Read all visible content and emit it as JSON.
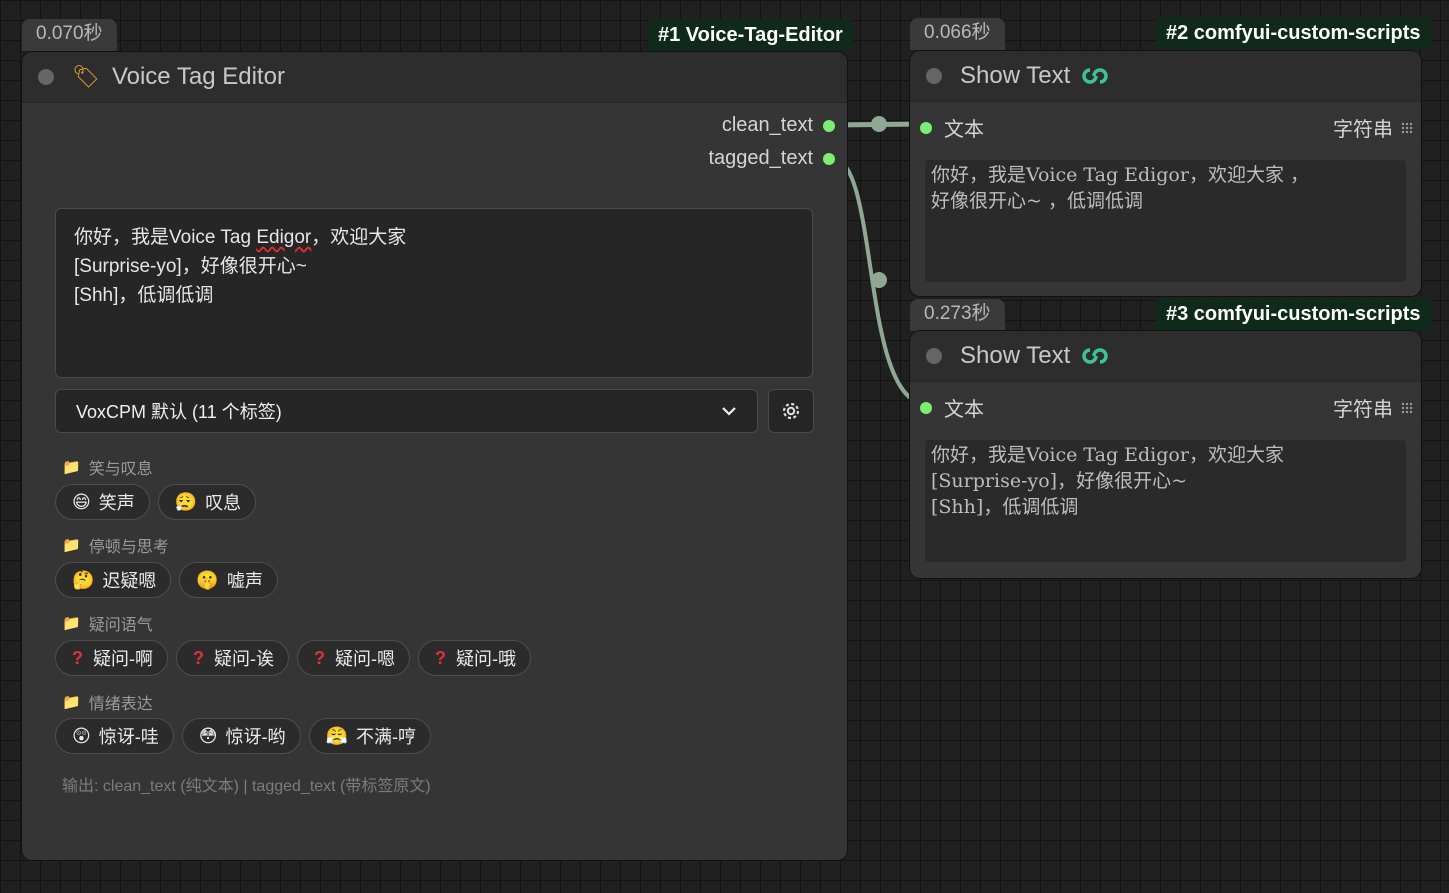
{
  "nodes": {
    "voice_tag_editor": {
      "time": "0.070秒",
      "badge": "#1 Voice-Tag-Editor",
      "title": "Voice Tag Editor",
      "outputs": [
        "clean_text",
        "tagged_text"
      ],
      "text_lines": [
        "你好，我是Voice Tag ",
        "Edigor",
        "，欢迎大家",
        "[Surprise-yo]，好像很开心~",
        "[Shh]，低调低调"
      ],
      "preset_select": "VoxCPM 默认 (11 个标签)",
      "categories": [
        {
          "name": "笑与叹息",
          "tags": [
            {
              "emoji": "😄",
              "label": "笑声"
            },
            {
              "emoji": "😮‍💨",
              "label": "叹息"
            }
          ]
        },
        {
          "name": "停顿与思考",
          "tags": [
            {
              "emoji": "🤔",
              "label": "迟疑嗯"
            },
            {
              "emoji": "🤫",
              "label": "嘘声"
            }
          ]
        },
        {
          "name": "疑问语气",
          "tags": [
            {
              "emoji": "?",
              "label": "疑问-啊"
            },
            {
              "emoji": "?",
              "label": "疑问-诶"
            },
            {
              "emoji": "?",
              "label": "疑问-嗯"
            },
            {
              "emoji": "?",
              "label": "疑问-哦"
            }
          ]
        },
        {
          "name": "情绪表达",
          "tags": [
            {
              "emoji": "😲",
              "label": "惊讶-哇"
            },
            {
              "emoji": "😳",
              "label": "惊讶-哟"
            },
            {
              "emoji": "😤",
              "label": "不满-哼"
            }
          ]
        }
      ],
      "footer": "输出: clean_text (纯文本) | tagged_text (带标签原文)"
    },
    "show_text_2": {
      "time": "0.066秒",
      "badge": "#2 comfyui-custom-scripts",
      "title": "Show Text",
      "input_label": "文本",
      "input_type": "字符串",
      "lines": [
        "你好，我是Voice Tag Edigor，欢迎大家 ，",
        "好像很开心~ ，低调低调"
      ]
    },
    "show_text_3": {
      "time": "0.273秒",
      "badge": "#3 comfyui-custom-scripts",
      "title": "Show Text",
      "input_label": "文本",
      "input_type": "字符串",
      "lines": [
        "你好，我是Voice Tag Edigor，欢迎大家",
        "[Surprise-yo]，好像很开心~",
        "[Shh]，低调低调"
      ]
    }
  },
  "colors": {
    "slot": "#7bef73",
    "wire": "#8fa893",
    "badge_bg": "#0f2a1a"
  }
}
